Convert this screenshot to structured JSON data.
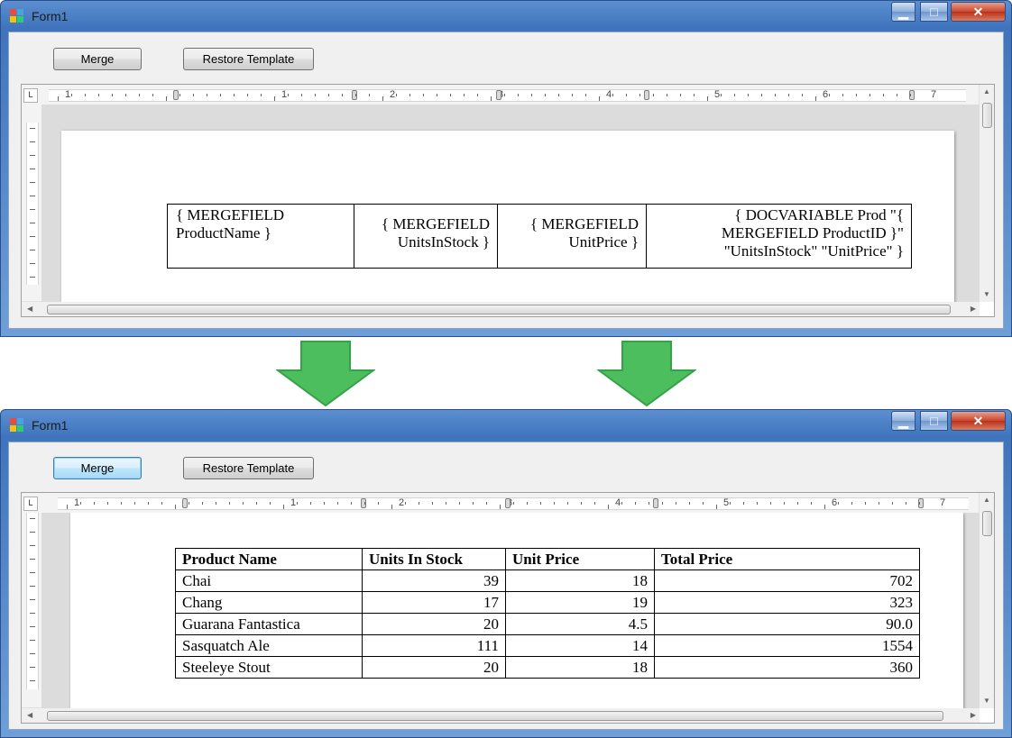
{
  "windows": [
    {
      "title": "Form1",
      "buttons": {
        "merge": "Merge",
        "restore": "Restore Template"
      },
      "ruler_numbers": [
        "1",
        "1",
        "2",
        "3",
        "4",
        "5",
        "6",
        "7"
      ],
      "ruler_corner": "L",
      "template_cells": [
        "{ MERGEFIELD ProductName }",
        "{ MERGEFIELD UnitsInStock }",
        "{ MERGEFIELD UnitPrice }",
        "{ DOCVARIABLE Prod \"{ MERGEFIELD ProductID }\" \"UnitsInStock\" \"UnitPrice\" }"
      ]
    },
    {
      "title": "Form1",
      "buttons": {
        "merge": "Merge",
        "restore": "Restore Template"
      },
      "ruler_numbers": [
        "1",
        "1",
        "2",
        "3",
        "4",
        "5",
        "6",
        "7"
      ],
      "ruler_corner": "L",
      "result_table": {
        "headers": [
          "Product Name",
          "Units In Stock",
          "Unit Price",
          "Total Price"
        ],
        "rows": [
          [
            "Chai",
            "39",
            "18",
            "702"
          ],
          [
            "Chang",
            "17",
            "19",
            "323"
          ],
          [
            "Guarana Fantastica",
            "20",
            "4.5",
            "90.0"
          ],
          [
            "Sasquatch Ale",
            "111",
            "14",
            "1554"
          ],
          [
            "Steeleye Stout",
            "20",
            "18",
            "360"
          ]
        ]
      }
    }
  ],
  "window_controls": {
    "minimize_icon": "minimize-icon",
    "maximize_icon": "maximize-icon",
    "close_icon": "close-icon"
  },
  "colors": {
    "arrow_green": "#4cbe5e",
    "arrow_outline": "#35a24a",
    "focus_blue": "#3c7fb1"
  }
}
